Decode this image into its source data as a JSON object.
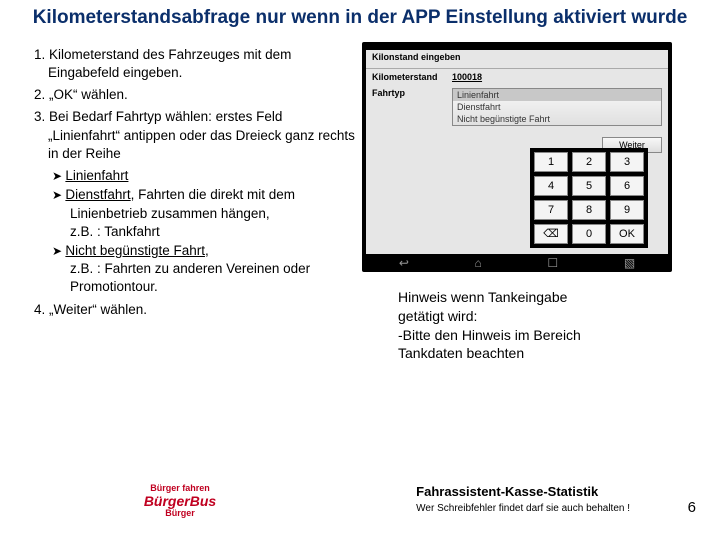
{
  "title": "Kilometerstandsabfrage nur wenn in der APP Einstellung aktiviert wurde",
  "steps": {
    "s1": "1.  Kilometerstand des Fahrzeuges mit dem Eingabefeld eingeben.",
    "s2": "2. „OK“ wählen.",
    "s3": "3.  Bei Bedarf Fahrtyp wählen: erstes Feld „Linienfahrt“ antippen oder das Dreieck ganz rechts in der Reihe",
    "b1": "Linienfahrt",
    "b2_a": "Dienstfahrt",
    "b2_b": ", Fahrten die direkt mit dem Linienbetrieb zusammen hängen,",
    "b2_c": "z.B. : Tankfahrt",
    "b3_a": "Nicht begünstigte Fahrt",
    "b3_b": ",",
    "b3_c": "z.B. : Fahrten zu anderen Vereinen oder Promotiontour.",
    "s4": "4. „Weiter“ wählen."
  },
  "hint": {
    "l1": "Hinweis wenn Tankeingabe",
    "l2": "getätigt wird:",
    "l3": "-Bitte den Hinweis im Bereich",
    "l4": " Tankdaten beachten"
  },
  "phone": {
    "header": "Kilonstand eingeben",
    "label_km": "Kilometerstand",
    "value_km": "100018",
    "label_type": "Fahrtyp",
    "dd_sel": "Linienfahrt",
    "dd_opt1": "Dienstfahrt",
    "dd_opt2": "Nicht begünstigte Fahrt",
    "weiter": "Weiter",
    "keys": [
      "1",
      "2",
      "3",
      "4",
      "5",
      "6",
      "7",
      "8",
      "9",
      "⌫",
      "0",
      "OK"
    ]
  },
  "footer": {
    "logo_top": "Bürger fahren",
    "logo_mid": "BürgerBus",
    "logo_bot": "Bürger",
    "stat": "Fahrassistent-Kasse-Statistik",
    "disclaimer": "Wer Schreibfehler findet darf sie auch behalten !",
    "page": "6"
  }
}
